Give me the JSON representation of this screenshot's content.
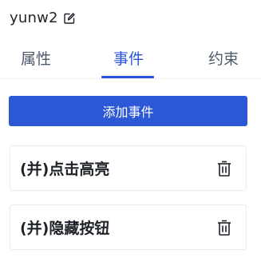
{
  "header": {
    "title": "yunw2",
    "edit_icon": "edit-icon"
  },
  "tabs": [
    {
      "label": "属性",
      "active": false
    },
    {
      "label": "事件",
      "active": true
    },
    {
      "label": "约束",
      "active": false
    }
  ],
  "add_button": {
    "label": "添加事件"
  },
  "events": [
    {
      "label": "(并)点击高亮",
      "icon": "trash-icon"
    },
    {
      "label": "(并)隐藏按钮",
      "icon": "trash-icon"
    }
  ],
  "colors": {
    "accent": "#2c58d6",
    "text": "#1f2329",
    "muted": "#4e5969"
  }
}
